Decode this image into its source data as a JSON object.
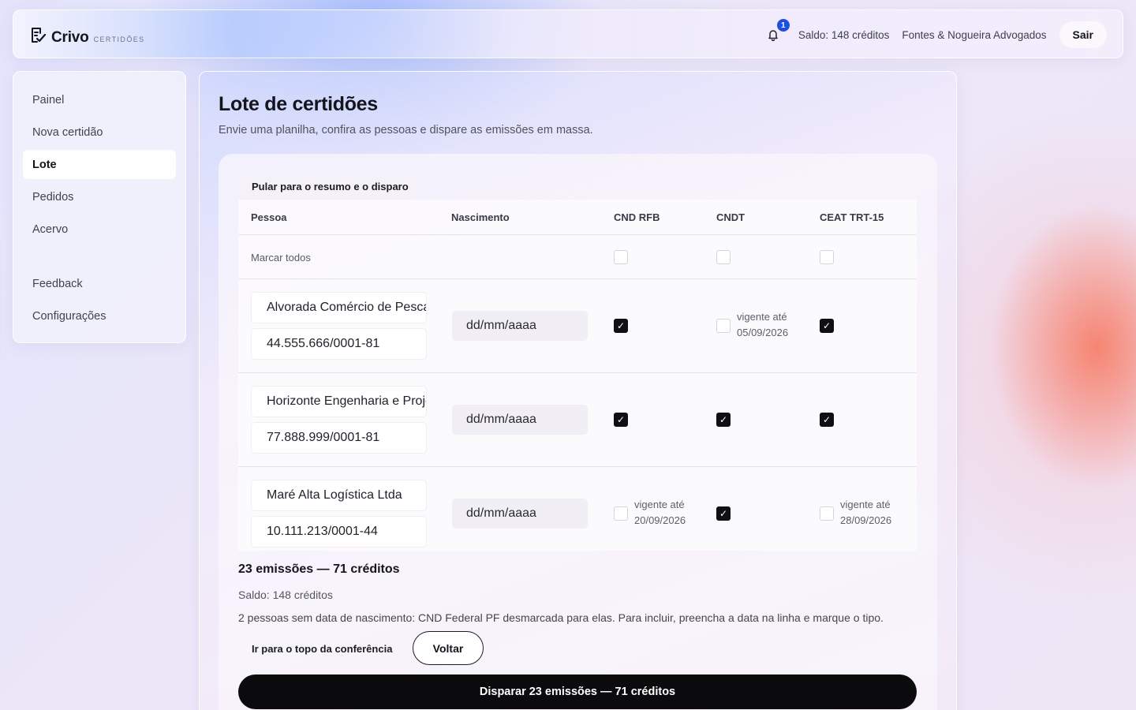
{
  "header": {
    "brand": "Crivo",
    "brand_sub": "CERTIDÕES",
    "notification_count": "1",
    "balance": "Saldo: 148 créditos",
    "org": "Fontes & Nogueira Advogados",
    "logout_label": "Sair"
  },
  "sidebar": {
    "items": [
      {
        "label": "Painel"
      },
      {
        "label": "Nova certidão"
      },
      {
        "label": "Lote",
        "active": true
      },
      {
        "label": "Pedidos"
      },
      {
        "label": "Acervo"
      },
      {
        "label": "Feedback"
      },
      {
        "label": "Configurações"
      }
    ]
  },
  "main": {
    "title": "Lote de certidões",
    "subtitle": "Envie uma planilha, confira as pessoas e dispare as emissões em massa.",
    "skip_link": "Pular para o resumo e o disparo",
    "table": {
      "headers": [
        "Pessoa",
        "Nascimento",
        "CND RFB",
        "CNDT",
        "CEAT TRT-15"
      ],
      "select_all": "Marcar todos",
      "select_all_checked": [
        false,
        false,
        false
      ],
      "date_placeholder": "dd/mm/aaaa",
      "validity_prefix": "vigente até",
      "rows": [
        {
          "name": "Alvorada Comércio de Pescados Ltda",
          "doc": "44.555.666/0001-81",
          "birth": "dd/mm/aaaa",
          "checks": [
            true,
            false,
            true
          ],
          "validity": [
            "",
            "05/09/2026",
            ""
          ]
        },
        {
          "name": "Horizonte Engenharia e Projetos Ltda",
          "doc": "77.888.999/0001-81",
          "birth": "dd/mm/aaaa",
          "checks": [
            true,
            true,
            true
          ],
          "validity": [
            "",
            "",
            ""
          ]
        },
        {
          "name": "Maré Alta Logística Ltda",
          "doc": "10.111.213/0001-44",
          "birth": "dd/mm/aaaa",
          "checks": [
            false,
            true,
            false
          ],
          "validity": [
            "20/09/2026",
            "",
            "28/09/2026"
          ]
        }
      ]
    },
    "summary": {
      "title": "23 emissões — 71 créditos",
      "balance": "Saldo: 148 créditos",
      "note": "2 pessoas sem data de nascimento: CND Federal PF desmarcada para elas. Para incluir, preencha a data na linha e marque o tipo.",
      "top_link": "Ir para o topo da conferência",
      "back_label": "Voltar",
      "fire_label": "Disparar 23 emissões — 71 créditos"
    }
  }
}
